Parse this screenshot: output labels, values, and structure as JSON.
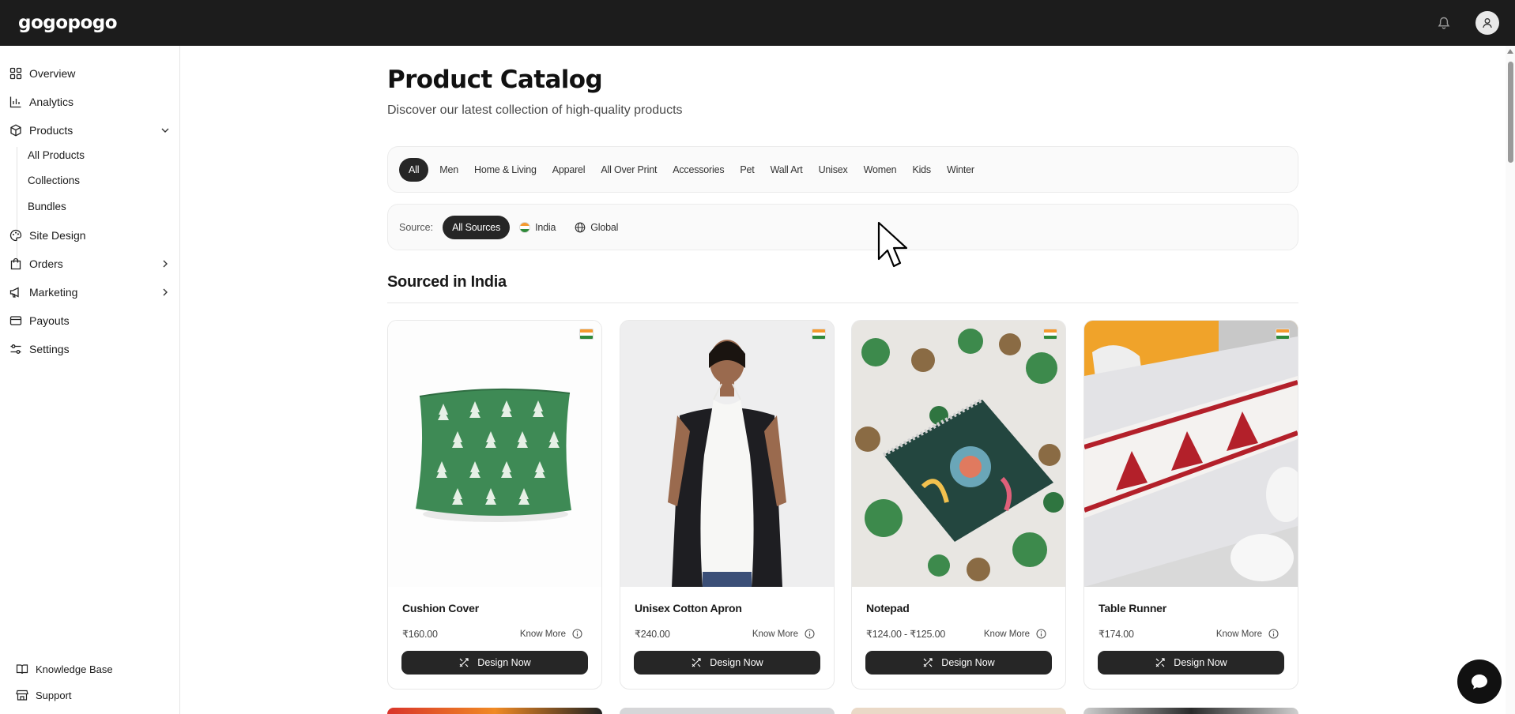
{
  "app": {
    "logo": "gogopogo"
  },
  "sidebar": {
    "items": [
      {
        "label": "Overview",
        "icon": "grid-icon"
      },
      {
        "label": "Analytics",
        "icon": "bar-chart-icon"
      },
      {
        "label": "Products",
        "icon": "box-icon",
        "expanded": true
      },
      {
        "label": "Site Design",
        "icon": "palette-icon"
      },
      {
        "label": "Orders",
        "icon": "shopping-bag-icon"
      },
      {
        "label": "Marketing",
        "icon": "megaphone-icon"
      },
      {
        "label": "Payouts",
        "icon": "credit-card-icon"
      },
      {
        "label": "Settings",
        "icon": "sliders-icon"
      }
    ],
    "product_sub": [
      "All Products",
      "Collections",
      "Bundles"
    ],
    "bottom": [
      {
        "label": "Knowledge Base",
        "icon": "book-icon"
      },
      {
        "label": "Support",
        "icon": "store-icon"
      }
    ]
  },
  "page": {
    "title": "Product Catalog",
    "subtitle": "Discover our latest collection of high-quality products"
  },
  "categories": [
    "All",
    "Men",
    "Home & Living",
    "Apparel",
    "All Over Print",
    "Accessories",
    "Pet",
    "Wall Art",
    "Unisex",
    "Women",
    "Kids",
    "Winter"
  ],
  "source": {
    "label": "Source:",
    "options": [
      "All Sources",
      "India",
      "Global"
    ]
  },
  "section": {
    "title": "Sourced in India"
  },
  "products": [
    {
      "name": "Cushion Cover",
      "price": "₹160.00",
      "know_more": "Know More",
      "cta": "Design Now"
    },
    {
      "name": "Unisex Cotton Apron",
      "price": "₹240.00",
      "know_more": "Know More",
      "cta": "Design Now"
    },
    {
      "name": "Notepad",
      "price": "₹124.00 - ₹125.00",
      "know_more": "Know More",
      "cta": "Design Now"
    },
    {
      "name": "Table Runner",
      "price": "₹174.00",
      "know_more": "Know More",
      "cta": "Design Now"
    }
  ],
  "colors": {
    "topbar": "#1c1c1c",
    "accent_dark": "#262626",
    "flag_saffron": "#f59a2f",
    "flag_green": "#2f8a3a"
  }
}
